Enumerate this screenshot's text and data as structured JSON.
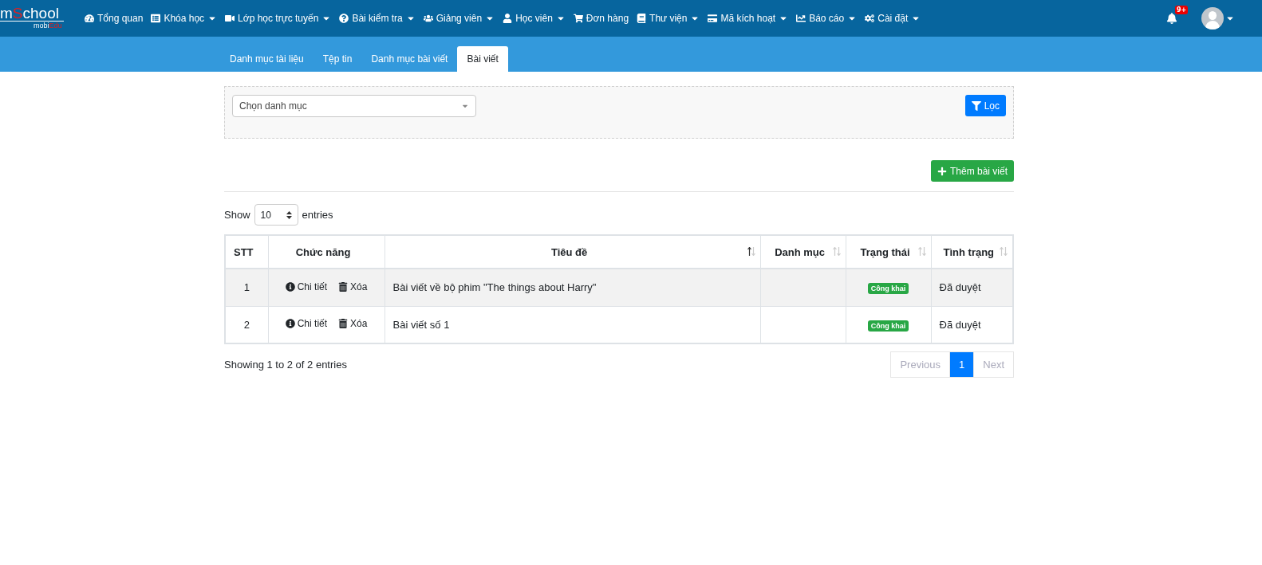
{
  "logo": {
    "prefix": "m",
    "accent": "S",
    "rest": "chool",
    "sub": "mobi",
    "sub_accent": "Edu"
  },
  "nav": [
    {
      "label": "Tổng quan",
      "dropdown": false
    },
    {
      "label": "Khóa học",
      "dropdown": true
    },
    {
      "label": "Lớp học trực tuyến",
      "dropdown": true
    },
    {
      "label": "Bài kiểm tra",
      "dropdown": true
    },
    {
      "label": "Giảng viên",
      "dropdown": true
    },
    {
      "label": "Học viên",
      "dropdown": true
    },
    {
      "label": "Đơn hàng",
      "dropdown": false
    },
    {
      "label": "Thư viện",
      "dropdown": true
    },
    {
      "label": "Mã kích hoạt",
      "dropdown": true
    },
    {
      "label": "Báo cáo",
      "dropdown": true
    },
    {
      "label": "Cài đặt",
      "dropdown": true
    }
  ],
  "notifications": {
    "badge": "9+"
  },
  "tabs": [
    {
      "label": "Danh mục tài liệu",
      "selected": false
    },
    {
      "label": "Tệp tin",
      "selected": false
    },
    {
      "label": "Danh mục bài viết",
      "selected": false
    },
    {
      "label": "Bài viết",
      "selected": true
    }
  ],
  "filter": {
    "select": "Chọn danh mục",
    "button": "Lọc"
  },
  "add_button": "Thêm bài viết",
  "length": {
    "show": "Show",
    "value": "10",
    "entries": "entries"
  },
  "table": {
    "columns": [
      {
        "label": "STT",
        "sortable": false
      },
      {
        "label": "Chức năng",
        "sortable": false
      },
      {
        "label": "Tiêu đề",
        "sortable": true,
        "sorted": true
      },
      {
        "label": "Danh mục",
        "sortable": true,
        "sorted": false
      },
      {
        "label": "Trạng thái",
        "sortable": true,
        "sorted": false
      },
      {
        "label": "Tình trạng",
        "sortable": true,
        "sorted": false
      }
    ],
    "rows": [
      {
        "stt": "1",
        "detail": "Chi tiết",
        "delete": "Xóa",
        "title": "Bài viết về bộ phim \"The things about Harry\"",
        "status": "Công khai",
        "state": "Đã duyệt"
      },
      {
        "stt": "2",
        "detail": "Chi tiết",
        "delete": "Xóa",
        "title": "Bài viết số 1",
        "status": "Công khai",
        "state": "Đã duyệt"
      }
    ]
  },
  "info": "Showing 1 to 2 of 2 entries",
  "pagination": [
    {
      "label": "Previous",
      "selected": false,
      "disabled": true
    },
    {
      "label": "1",
      "selected": true,
      "disabled": false
    },
    {
      "label": "Next",
      "selected": false,
      "disabled": true
    }
  ]
}
